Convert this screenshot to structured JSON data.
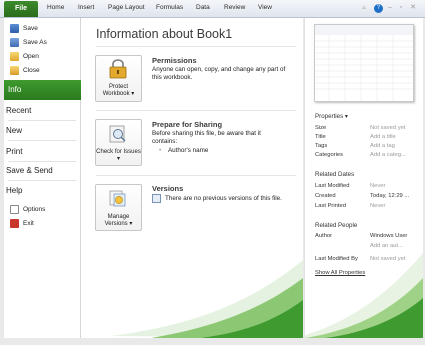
{
  "ribbon": {
    "file": "File",
    "tabs": [
      "Home",
      "Insert",
      "Page Layout",
      "Formulas",
      "Data",
      "Review",
      "View"
    ]
  },
  "sidebar": {
    "commands": [
      "Save",
      "Save As",
      "Open",
      "Close"
    ],
    "selected": "Info",
    "nav": [
      "Recent",
      "New",
      "Print",
      "Save & Send",
      "Help"
    ],
    "bottom": [
      "Options",
      "Exit"
    ]
  },
  "main": {
    "title": "Information about Book1",
    "permissions": {
      "button": "Protect Workbook",
      "heading": "Permissions",
      "desc": "Anyone can open, copy, and change any part of this workbook."
    },
    "sharing": {
      "button": "Check for Issues",
      "heading": "Prepare for Sharing",
      "desc": "Before sharing this file, be aware that it contains:",
      "item": "Author's name"
    },
    "versions": {
      "button": "Manage Versions",
      "heading": "Versions",
      "desc": "There are no previous versions of this file."
    }
  },
  "properties": {
    "heading": "Properties",
    "rows": [
      {
        "label": "Size",
        "value": "Not saved yet"
      },
      {
        "label": "Title",
        "value": "Add a title"
      },
      {
        "label": "Tags",
        "value": "Add a tag"
      },
      {
        "label": "Categories",
        "value": "Add a categ..."
      }
    ],
    "dates_heading": "Related Dates",
    "dates": [
      {
        "label": "Last Modified",
        "value": "Never"
      },
      {
        "label": "Created",
        "value": "Today, 12:29 ..."
      },
      {
        "label": "Last Printed",
        "value": "Never"
      }
    ],
    "people_heading": "Related People",
    "author_label": "Author",
    "author_value": "Windows User",
    "add_author": "Add an aut...",
    "modified_by_label": "Last Modified By",
    "modified_by_value": "Not saved yet",
    "show_all": "Show All Properties"
  },
  "colors": {
    "accent_green": "#2f8322",
    "help_blue": "#1e6fc7"
  }
}
